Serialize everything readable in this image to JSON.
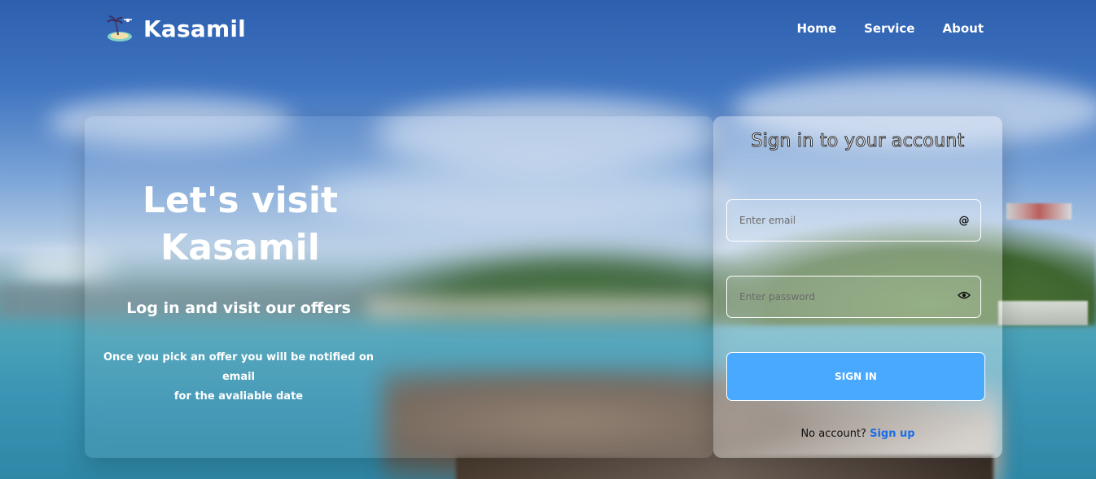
{
  "brand": {
    "name": "Kasamil",
    "logo_icon": "island-palm-icon"
  },
  "nav": {
    "items": [
      "Home",
      "Service",
      "About"
    ]
  },
  "hero": {
    "title_line1": "Let's visit",
    "title_line2": "Kasamil",
    "subtitle": "Log in and visit our offers",
    "description_line1": "Once you pick an offer you will be notified on email",
    "description_line2": "for the avaliable date"
  },
  "signin": {
    "title": "Sign in to your account",
    "email_placeholder": "Enter email",
    "email_icon": "@",
    "password_placeholder": "Enter password",
    "password_icon": "eye-icon",
    "button_label": "SIGN IN",
    "footer_text": "No account?",
    "signup_label": "Sign up"
  },
  "colors": {
    "accent": "#49a9ff",
    "link": "#1a6ee8"
  }
}
